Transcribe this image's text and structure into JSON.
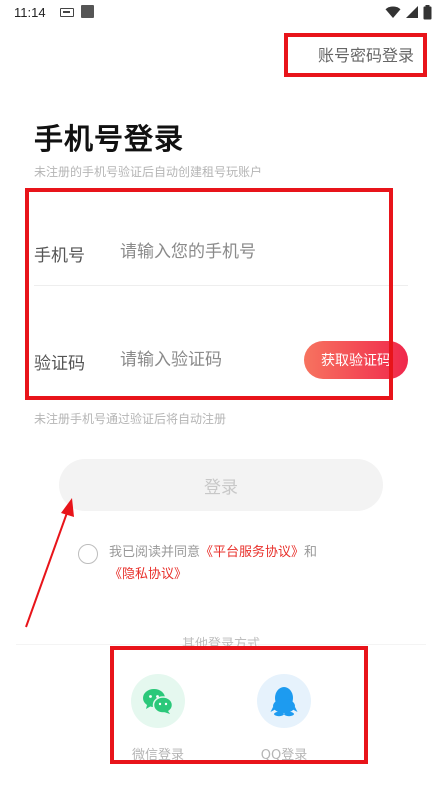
{
  "status_bar": {
    "time": "11:14",
    "icons": [
      "notification-icon",
      "app-icon",
      "wifi-icon",
      "signal-icon",
      "battery-icon"
    ]
  },
  "header": {
    "account_login_label": "账号密码登录"
  },
  "main": {
    "title": "手机号登录",
    "subtitle": "未注册的手机号验证后自动创建租号玩账户",
    "phone": {
      "label": "手机号",
      "placeholder": "请输入您的手机号",
      "value": ""
    },
    "code": {
      "label": "验证码",
      "placeholder": "请输入验证码",
      "value": "",
      "get_code_label": "获取验证码"
    },
    "hint": "未注册手机号通过验证后将自动注册",
    "login_label": "登录",
    "agreement": {
      "checked": false,
      "prefix": "我已阅读并同意",
      "platform_link": "《平台服务协议》",
      "and": "和",
      "privacy_link": "《隐私协议》"
    }
  },
  "other_login": {
    "title": "其他登录方式",
    "options": [
      {
        "label": "微信登录",
        "icon": "wechat-icon"
      },
      {
        "label": "QQ登录",
        "icon": "qq-icon"
      }
    ]
  },
  "colors": {
    "accent_gradient_start": "#f7735f",
    "accent_gradient_end": "#f0284c",
    "link": "#e8302b",
    "annotation": "#e8141a",
    "wechat": "#2bc87a",
    "qq": "#1d9bf0"
  }
}
